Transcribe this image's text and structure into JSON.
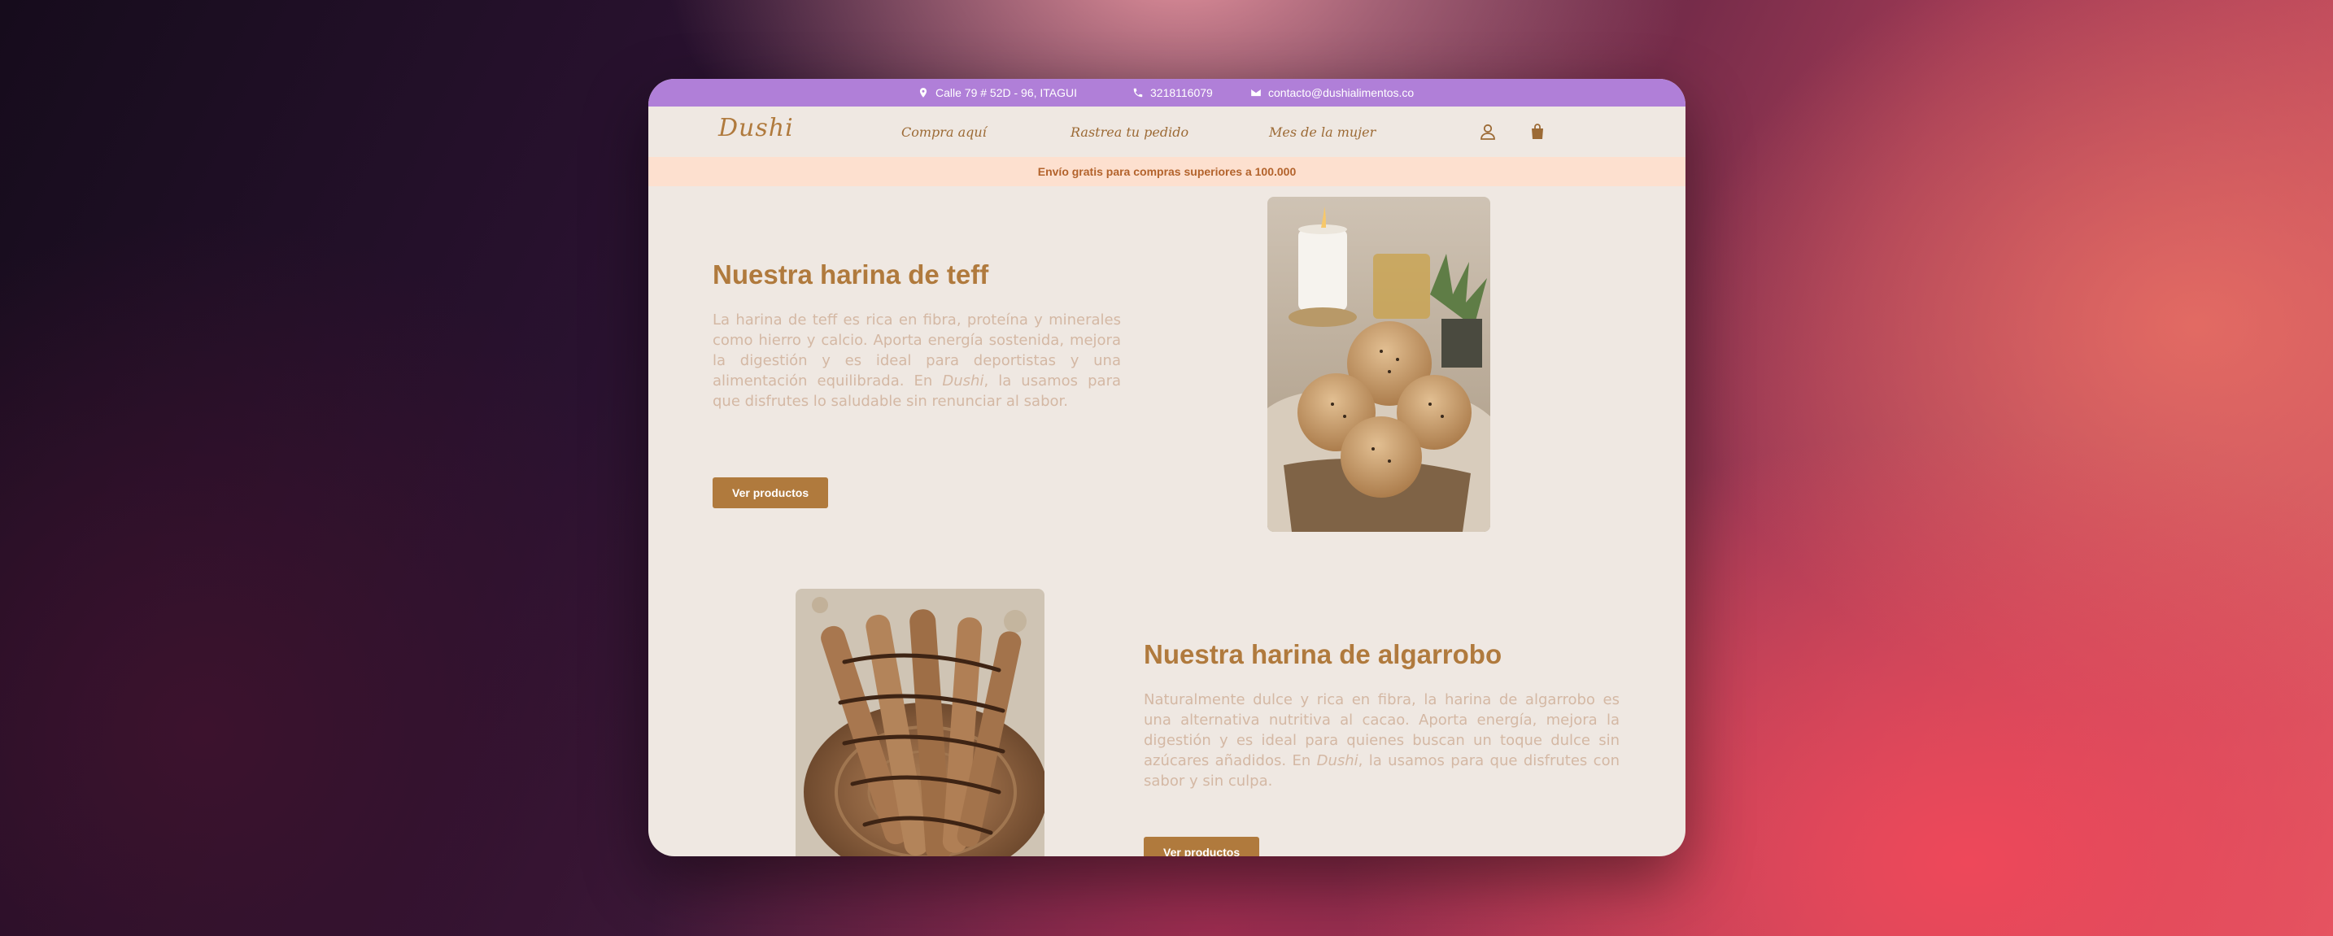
{
  "topbar": {
    "address": "Calle 79 # 52D - 96, ITAGUI",
    "phone": "3218116079",
    "email": "contacto@dushialimentos.co",
    "background": "#b07fd8"
  },
  "brand": {
    "name": "Dushi"
  },
  "nav": {
    "items": [
      "Compra aquí",
      "Rastrea tu pedido",
      "Mes de la mujer"
    ],
    "icons": [
      "user-icon",
      "shopping-bag-icon"
    ]
  },
  "promo": {
    "text": "Envío gratis para compras superiores a 100.000"
  },
  "sections": [
    {
      "title": "Nuestra harina de teff",
      "text_before": "La harina de teff es rica en fibra, proteína y minerales como hierro y calcio. Aporta energía sostenida, mejora la digestión y es ideal para deportistas y una alimentación equilibrada. En ",
      "brand": "Dushi",
      "text_after": ", la usamos para que disfrutes lo saludable sin renunciar al sabor.",
      "button": "Ver productos",
      "image": "teff-bread-photo"
    },
    {
      "title": "Nuestra harina de algarrobo",
      "text_before": "Naturalmente dulce y rica en fibra, la harina de algarrobo es una alternativa nutritiva al cacao. Aporta energía, mejora la digestión y es ideal para quienes buscan un toque dulce sin azúcares añadidos. En ",
      "brand": "Dushi",
      "text_after": ", la usamos para que disfrutes con sabor y sin culpa.",
      "button": "Ver productos",
      "image": "carob-breadsticks-photo"
    }
  ],
  "colors": {
    "accent": "#b07a3d",
    "page_bg": "#efe8e2",
    "promo_bg": "#fde0cf",
    "body_text": "#d4b8a4"
  }
}
